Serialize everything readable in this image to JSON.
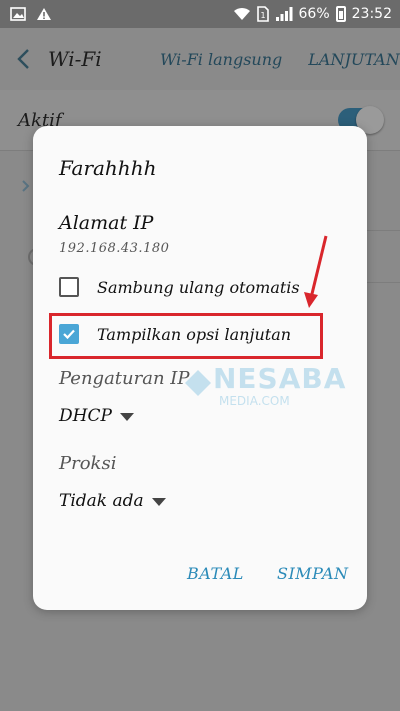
{
  "status_bar": {
    "battery_percent": "66%",
    "time": "23:52",
    "icons": [
      "image-icon",
      "warning-icon",
      "wifi-icon",
      "sim-icon",
      "signal-icon",
      "battery-icon"
    ]
  },
  "app_bar": {
    "title": "Wi-Fi",
    "action_direct": "Wi-Fi langsung",
    "action_advanced": "LANJUTAN"
  },
  "background": {
    "aktif_label": "Aktif",
    "toggle_on": true
  },
  "dialog": {
    "network_name": "Farahhhh",
    "ip_label": "Alamat IP",
    "ip_value": "192.168.43.180",
    "checkbox_reconnect": {
      "label": "Sambung ulang otomatis",
      "checked": false
    },
    "checkbox_advanced": {
      "label": "Tampilkan opsi lanjutan",
      "checked": true
    },
    "ip_settings_label": "Pengaturan IP",
    "ip_settings_value": "DHCP",
    "proxy_label": "Proksi",
    "proxy_value": "Tidak ada",
    "cancel_label": "BATAL",
    "save_label": "SIMPAN"
  },
  "watermark": {
    "text": "NESABA",
    "sub": "MEDIA.COM"
  },
  "colors": {
    "accent": "#4aa6d6",
    "highlight": "#d9262c",
    "button_text": "#2a8ab8"
  }
}
